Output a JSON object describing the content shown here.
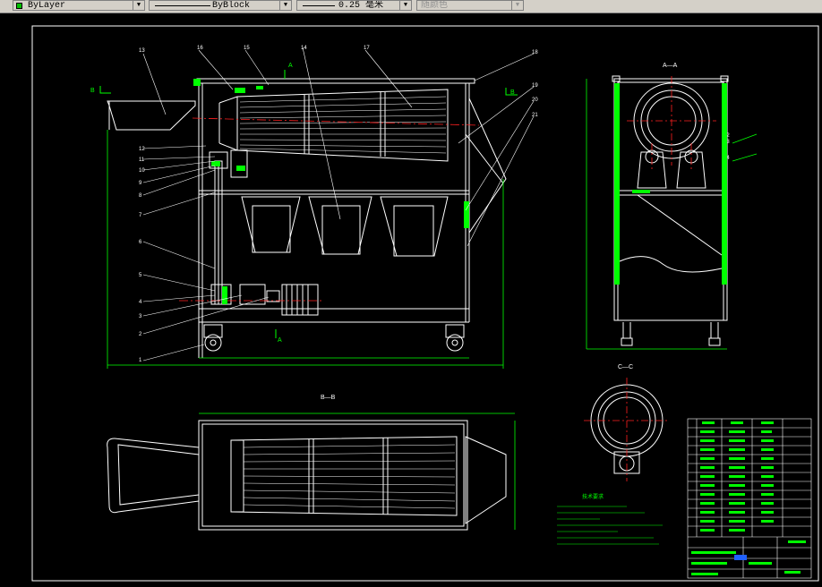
{
  "toolbar": {
    "color_value": "ByLayer",
    "linetype_value": "ByBlock",
    "lineweight_value": "0.25 毫米",
    "plotstyle_value": "随颜色",
    "swatch_color": "#00c000"
  },
  "drawing": {
    "section_aa": "A—A",
    "section_bb": "B—B",
    "section_cc": "C—C",
    "mark_a": "A",
    "mark_b": "B",
    "part_numbers": [
      "1",
      "2",
      "3",
      "4",
      "5",
      "6",
      "7",
      "8",
      "9",
      "10",
      "11",
      "12",
      "13",
      "14",
      "15",
      "16",
      "17",
      "18",
      "19",
      "20",
      "21",
      "22",
      "23",
      "24"
    ],
    "tech_req_title": "技术要求",
    "colors": {
      "frame": "#ffffff",
      "part": "#ffffff",
      "dim": "#00ff00",
      "center": "#ff2020",
      "leader": "#ffffff"
    }
  }
}
